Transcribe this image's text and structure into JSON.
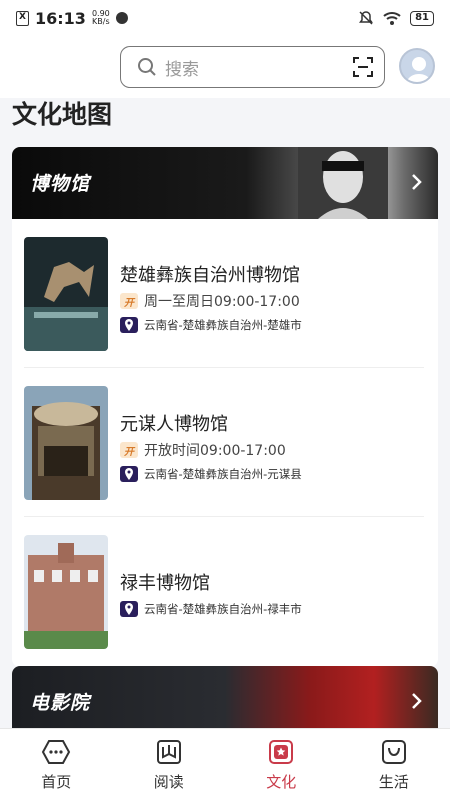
{
  "status_bar": {
    "sim_label": "X",
    "time": "16:13",
    "speed_value": "0.90",
    "speed_unit": "KB/s",
    "battery": "81"
  },
  "search": {
    "placeholder": "搜索"
  },
  "page_title": "文化地图",
  "museum_section": {
    "title": "博物馆",
    "items": [
      {
        "name": "楚雄彝族自治州博物馆",
        "open_badge": "开",
        "hours": "周一至周日09:00-17:00",
        "location": "云南省-楚雄彝族自治州-楚雄市"
      },
      {
        "name": "元谋人博物馆",
        "open_badge": "开",
        "hours": "开放时间09:00-17:00",
        "location": "云南省-楚雄彝族自治州-元谋县"
      },
      {
        "name": "禄丰博物馆",
        "location": "云南省-楚雄彝族自治州-禄丰市"
      }
    ]
  },
  "cinema_section": {
    "title": "电影院"
  },
  "bottom_nav": {
    "tabs": [
      {
        "label": "首页",
        "icon": "home-icon"
      },
      {
        "label": "阅读",
        "icon": "book-icon"
      },
      {
        "label": "文化",
        "icon": "culture-icon",
        "active": true
      },
      {
        "label": "生活",
        "icon": "life-icon"
      }
    ],
    "active_color": "#c93b4a"
  }
}
